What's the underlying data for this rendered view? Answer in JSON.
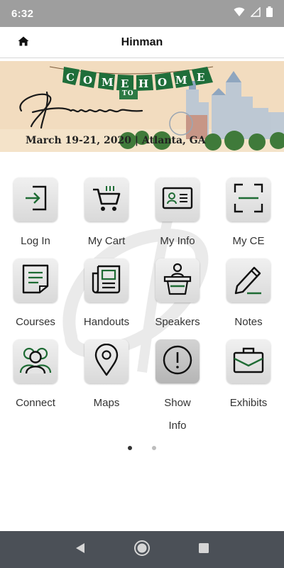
{
  "status_bar": {
    "time": "6:32",
    "icons": [
      "wifi-icon",
      "signal-icon",
      "battery-icon"
    ]
  },
  "header": {
    "title": "Hinman",
    "home_icon": "home-icon"
  },
  "banner": {
    "headline": "COME HOME",
    "connector": "TO",
    "brand_script": "Hinman",
    "date_location": "March 19-21, 2020 | Atlanta, GA"
  },
  "tiles": [
    {
      "label": "Log In",
      "icon": "login-icon"
    },
    {
      "label": "My Cart",
      "icon": "cart-icon"
    },
    {
      "label": "My Info",
      "icon": "id-card-icon"
    },
    {
      "label": "My CE",
      "icon": "scan-frame-icon"
    },
    {
      "label": "Courses",
      "icon": "document-icon"
    },
    {
      "label": "Handouts",
      "icon": "newspaper-icon"
    },
    {
      "label": "Speakers",
      "icon": "podium-icon"
    },
    {
      "label": "Notes",
      "icon": "pencil-icon"
    },
    {
      "label": "Connect",
      "icon": "people-icon"
    },
    {
      "label": "Maps",
      "icon": "map-pin-icon"
    },
    {
      "label": "Show\nInfo",
      "icon": "info-alert-icon"
    },
    {
      "label": "Exhibits",
      "icon": "briefcase-icon"
    }
  ],
  "pager": {
    "pages": 2,
    "current": 1
  },
  "colors": {
    "accent_green": "#1e6b34",
    "status_bar": "#9e9e9e",
    "nav_bar": "#4b5057"
  }
}
